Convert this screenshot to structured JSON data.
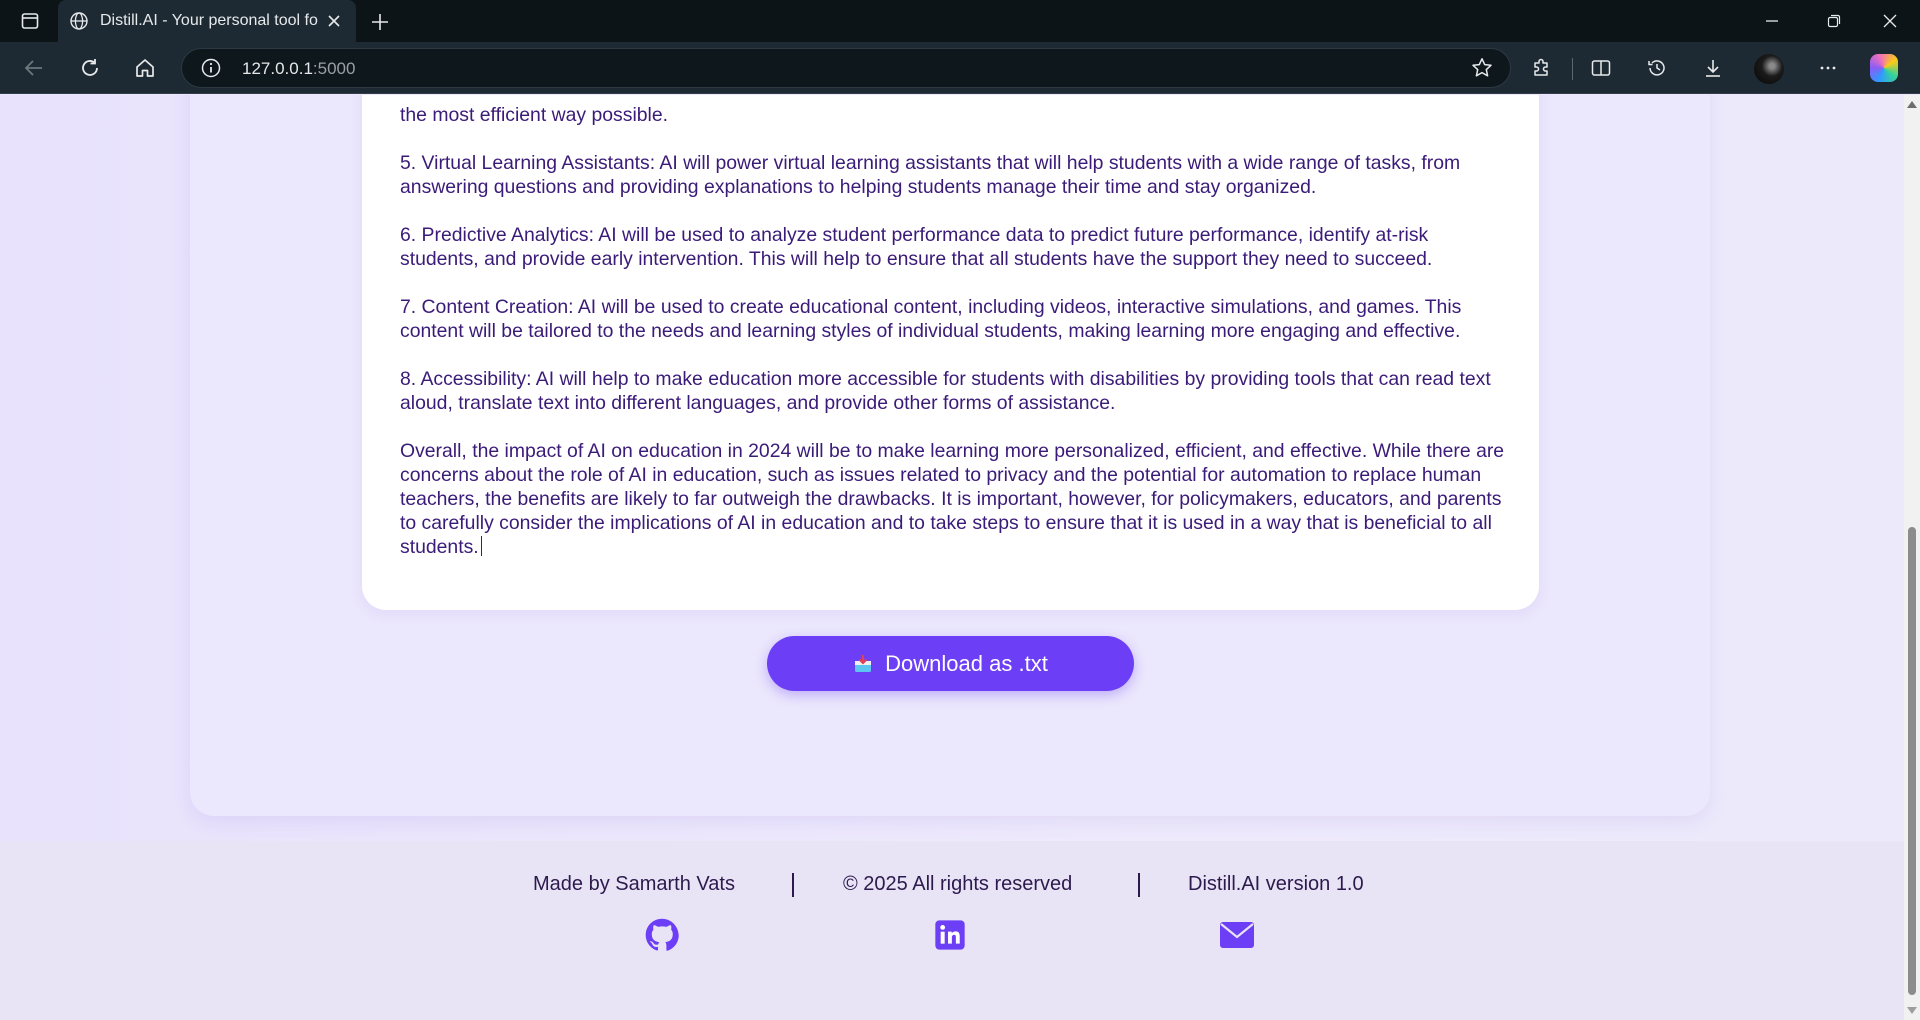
{
  "browser": {
    "tab_title": "Distill.AI - Your personal tool for d",
    "url_host": "127.0.0.1",
    "url_port": ":5000"
  },
  "content": {
    "paragraphs": [
      "the most efficient way possible.",
      "5. Virtual Learning Assistants: AI will power virtual learning assistants that will help students with a wide range of tasks, from answering questions and providing explanations to helping students manage their time and stay organized.",
      "6. Predictive Analytics: AI will be used to analyze student performance data to predict future performance, identify at-risk students, and provide early intervention. This will help to ensure that all students have the support they need to succeed.",
      "7. Content Creation: AI will be used to create educational content, including videos, interactive simulations, and games. This content will be tailored to the needs and learning styles of individual students, making learning more engaging and effective.",
      "8. Accessibility: AI will help to make education more accessible for students with disabilities by providing tools that can read text aloud, translate text into different languages, and provide other forms of assistance.",
      "Overall, the impact of AI on education in 2024 will be to make learning more personalized, efficient, and effective. While there are concerns about the role of AI in education, such as issues related to privacy and the potential for automation to replace human teachers, the benefits are likely to far outweigh the drawbacks. It is important, however, for policymakers, educators, and parents to carefully consider the implications of AI in education and to take steps to ensure that it is used in a way that is beneficial to all students."
    ],
    "download_label": "Download as .txt"
  },
  "footer": {
    "made_by": "Made by Samarth Vats",
    "copyright": "© 2025 All rights reserved",
    "version": "Distill.AI version 1.0",
    "social_icons": [
      "github-icon",
      "linkedin-icon",
      "email-icon"
    ]
  },
  "colors": {
    "accent": "#6c3ef5",
    "text": "#3b1b78",
    "footer_text": "#2d1a4d"
  }
}
